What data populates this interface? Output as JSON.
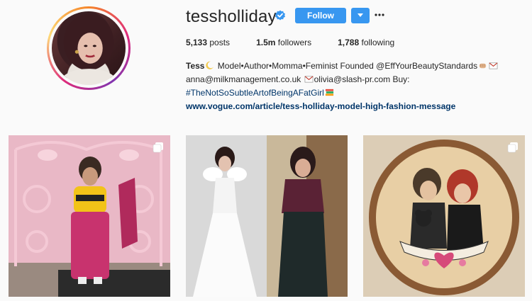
{
  "profile": {
    "username": "tessholliday",
    "follow_label": "Follow",
    "stats": [
      {
        "count": "5,133",
        "label": "posts"
      },
      {
        "count": "1.5m",
        "label": "followers"
      },
      {
        "count": "1,788",
        "label": "following"
      }
    ]
  },
  "bio": {
    "name": "Tess",
    "line1": " Model•Author•Momma•Feminist Founded @EffYourBeautyStandards",
    "email1": "anna@milkmanagement.co.uk ",
    "email2": "olivia@slash-pr.com Buy:",
    "hashtag": "#TheNotSoSubtleArtofBeingAFatGirl",
    "url": "www.vogue.com/article/tess-holliday-model-high-fashion-message"
  },
  "colors": {
    "accent": "#3897f0",
    "link": "#003569",
    "background": "#fafafa"
  },
  "icons": {
    "verified": "verified-badge-icon",
    "dropdown": "chevron-down-icon",
    "more": "more-icon",
    "multi": "multiple-photos-icon"
  }
}
